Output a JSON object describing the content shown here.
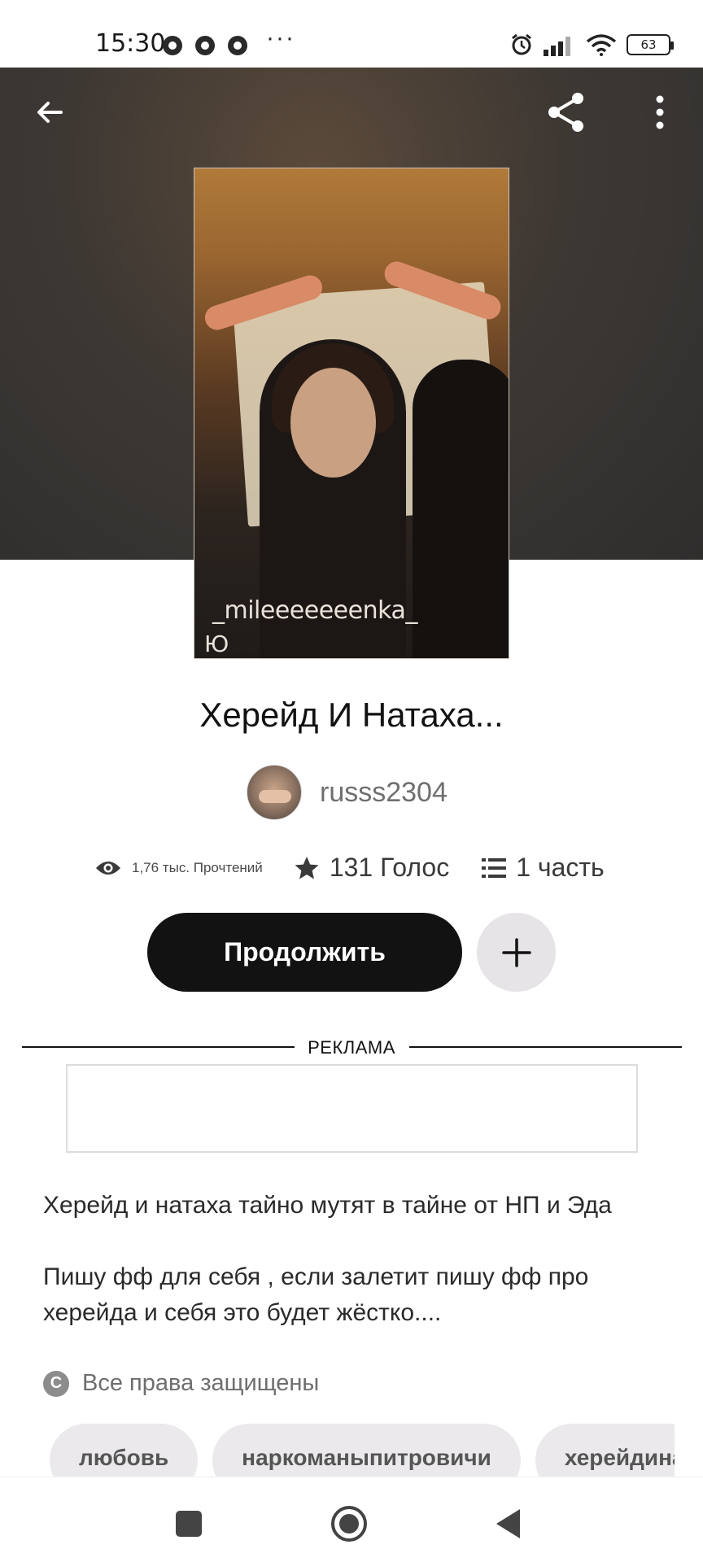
{
  "status_bar": {
    "time": "15:30",
    "dots": "···",
    "battery": "63"
  },
  "header": {
    "back_icon": "arrow-left-icon",
    "share_icon": "share-icon",
    "more_icon": "more-vertical-icon"
  },
  "cover": {
    "watermark": "_mileeeeeeenka_",
    "watermark2": "Ю"
  },
  "story": {
    "title": "Херейд И Натаха...",
    "author": "russs2304",
    "stats": {
      "reads": "1,76 тыс. Прочтений",
      "votes": "131 Голос",
      "parts": "1 часть"
    },
    "continue_label": "Продолжить",
    "ad_label": "РЕКЛАМА",
    "description": [
      "Херейд и натаха тайно мутят в тайне от НП и Эда",
      "Пишу фф для себя , если залетит пишу фф про херейда и себя это будет жёстко...."
    ],
    "rights": "Все права защищены",
    "tags": [
      "любовь",
      "наркоманыпитровичи",
      "херейдинатаха"
    ]
  },
  "colors": {
    "accent": "#121212",
    "hero_bg": "#353331",
    "secondary_button": "#e6e4e6",
    "tag_bg": "#ebe9ec"
  }
}
